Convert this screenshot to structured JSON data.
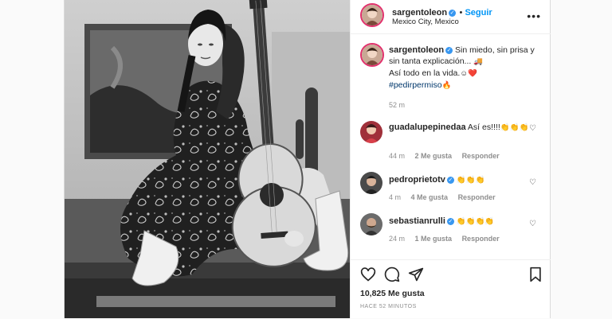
{
  "post": {
    "username": "sargentoleon",
    "follow_label": "Seguir",
    "location": "Mexico City, Mexico",
    "more_icon": "more-horizontal-icon",
    "image_alt": "black-and-white photo of a woman with an acoustic guitar"
  },
  "caption": {
    "username": "sargentoleon",
    "text_line1": "Sin miedo, sin prisa y sin tanta explicación...",
    "text_line2": "Así todo en la vida.",
    "hashtag": "#pedirpermiso",
    "time": "52 m"
  },
  "comments": [
    {
      "username": "guadalupepinedaa",
      "text": "Así es!!!!",
      "emojis": "👏👏👏",
      "time": "44 m",
      "likes": "2 Me gusta",
      "reply": "Responder"
    },
    {
      "username": "pedroprietotv",
      "text": "",
      "emojis": "👏👏👏",
      "time": "4 m",
      "likes": "4 Me gusta",
      "reply": "Responder"
    },
    {
      "username": "sebastianrulli",
      "text": "",
      "emojis": "👏👏👏👏",
      "time": "24 m",
      "likes": "1 Me gusta",
      "reply": "Responder"
    }
  ],
  "actions": {
    "likes": "10,825 Me gusta",
    "ago": "HACE 52 MINUTOS"
  },
  "colors": {
    "accent": "#0095f6",
    "verified": "#3897f0",
    "ring": "#e1306c"
  }
}
